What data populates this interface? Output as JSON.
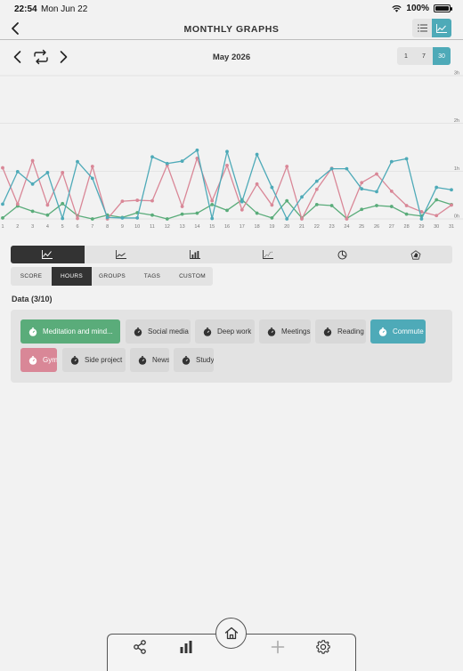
{
  "status": {
    "time": "22:54",
    "date": "Mon Jun 22",
    "battery": "100%"
  },
  "header": {
    "title": "MONTHLY GRAPHS"
  },
  "period": {
    "label": "May 2026",
    "ranges": [
      "1",
      "7",
      "30"
    ],
    "active_range": "30"
  },
  "chart_data": {
    "type": "line",
    "x": [
      1,
      2,
      3,
      4,
      5,
      6,
      7,
      8,
      9,
      10,
      11,
      12,
      13,
      14,
      15,
      16,
      17,
      18,
      19,
      20,
      21,
      22,
      23,
      24,
      25,
      26,
      27,
      28,
      29,
      30,
      31
    ],
    "ylim": [
      0,
      3
    ],
    "yticks": [
      "0h",
      "1h",
      "2h",
      "3h"
    ],
    "series": [
      {
        "color": "#5aac7a",
        "values": [
          0.02,
          0.27,
          0.16,
          0.08,
          0.32,
          0.07,
          0.0,
          0.08,
          0.03,
          0.13,
          0.08,
          0.0,
          0.1,
          0.12,
          0.3,
          0.18,
          0.4,
          0.12,
          0.02,
          0.38,
          0.02,
          0.3,
          0.28,
          0.01,
          0.2,
          0.28,
          0.26,
          0.1,
          0.06,
          0.4,
          0.3
        ]
      },
      {
        "color": "#d98797",
        "values": [
          1.07,
          0.31,
          1.22,
          0.29,
          0.97,
          0.01,
          1.1,
          0.0,
          0.37,
          0.39,
          0.38,
          1.13,
          0.26,
          1.27,
          0.38,
          1.12,
          0.19,
          0.73,
          0.29,
          1.1,
          0.0,
          0.62,
          1.06,
          0.0,
          0.76,
          0.94,
          0.58,
          0.28,
          0.15,
          0.07,
          0.29
        ]
      },
      {
        "color": "#4eaab8",
        "values": [
          0.31,
          0.99,
          0.73,
          0.97,
          0.01,
          1.2,
          0.85,
          0.03,
          0.02,
          0.02,
          1.3,
          1.16,
          1.21,
          1.44,
          0.01,
          1.41,
          0.36,
          1.35,
          0.66,
          0.0,
          0.46,
          0.79,
          1.05,
          1.05,
          0.63,
          0.57,
          1.2,
          1.26,
          0.0,
          0.66,
          0.61
        ]
      }
    ]
  },
  "modes": [
    "SCORE",
    "HOURS",
    "GROUPS",
    "TAGS",
    "CUSTOM"
  ],
  "active_mode": "HOURS",
  "data_section": {
    "title": "Data (3/10)",
    "items": [
      {
        "label": "Meditation and mind...",
        "state": "green"
      },
      {
        "label": "Social media",
        "state": "off"
      },
      {
        "label": "Deep work",
        "state": "off"
      },
      {
        "label": "Meetings",
        "state": "off"
      },
      {
        "label": "Reading",
        "state": "off"
      },
      {
        "label": "Commute",
        "state": "teal"
      },
      {
        "label": "Gym",
        "state": "pink"
      },
      {
        "label": "Side project",
        "state": "off"
      },
      {
        "label": "News",
        "state": "off"
      },
      {
        "label": "Study",
        "state": "off"
      }
    ]
  },
  "colors": {
    "accent": "#4eaab8",
    "green": "#5aac7a",
    "pink": "#d98797",
    "dark": "#333333"
  },
  "tabbar_icons": [
    "share-icon",
    "bar-chart-icon",
    "home-icon",
    "plus-icon",
    "settings-gear-icon"
  ]
}
